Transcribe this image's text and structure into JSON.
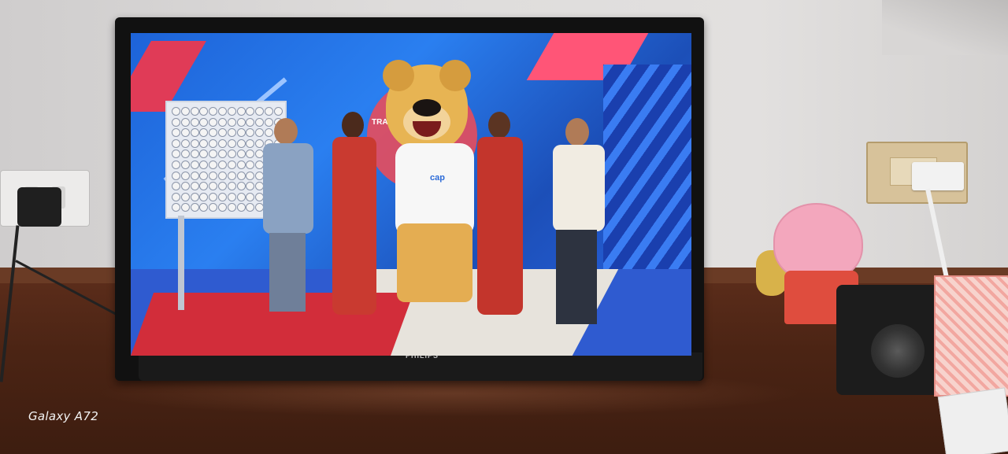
{
  "tv": {
    "brand": "PHILIPS"
  },
  "screen": {
    "sign_text": "TRAB",
    "mascot_shirt_text": "cap"
  },
  "photo": {
    "watermark": "Galaxy A72"
  },
  "colors": {
    "set_blue": "#1d63d8",
    "floor_red": "#d22d3a",
    "mascot": "#e7b453",
    "desk": "#4b2414"
  }
}
